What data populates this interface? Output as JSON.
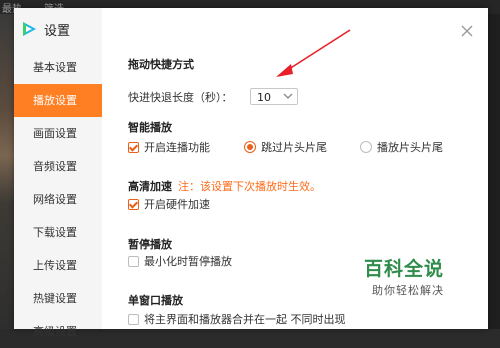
{
  "background": {
    "tab_hot": "最热",
    "tab_filter": "筛选"
  },
  "dialog": {
    "title": "设置",
    "nav": [
      {
        "label": "基本设置",
        "active": false
      },
      {
        "label": "播放设置",
        "active": true
      },
      {
        "label": "画面设置",
        "active": false
      },
      {
        "label": "音频设置",
        "active": false
      },
      {
        "label": "网络设置",
        "active": false
      },
      {
        "label": "下载设置",
        "active": false
      },
      {
        "label": "上传设置",
        "active": false
      },
      {
        "label": "热键设置",
        "active": false
      },
      {
        "label": "高级设置",
        "active": false
      }
    ],
    "seek": {
      "title": "拖动快捷方式",
      "label": "快进快退长度（秒）：",
      "value": "10"
    },
    "smart": {
      "title": "智能播放",
      "continuous": {
        "label": "开启连播功能",
        "checked": true
      },
      "skip_on": {
        "label": "跳过片头片尾",
        "selected": true
      },
      "skip_off": {
        "label": "播放片头片尾",
        "selected": false
      }
    },
    "hd": {
      "title": "高清加速",
      "note": "注：该设置下次播放时生效。",
      "hardware": {
        "label": "开启硬件加速",
        "checked": true
      }
    },
    "pause": {
      "title": "暂停播放",
      "minimize": {
        "label": "最小化时暂停播放",
        "checked": false
      }
    },
    "single": {
      "title": "单窗口播放",
      "merge": {
        "label": "将主界面和播放器合并在一起 不同时出现",
        "checked": false
      }
    }
  },
  "watermark": {
    "title": "百科全说",
    "subtitle": "助你轻松解决"
  },
  "colors": {
    "accent": "#ff7f22",
    "note": "#ff6b1a",
    "annotation_arrow": "#e8202a",
    "watermark": "#2f8c4a"
  }
}
